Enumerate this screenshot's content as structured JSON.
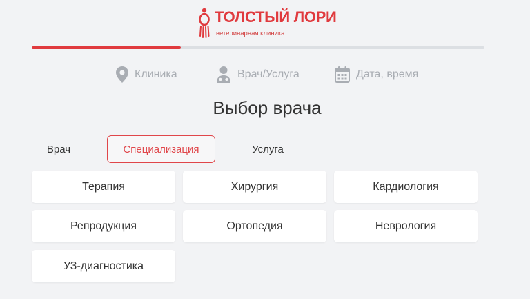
{
  "logo": {
    "title": "ТОЛСТЫЙ ЛОРИ",
    "subtitle": "ветеринарная клиника",
    "brand_color": "#e03a3e"
  },
  "progress": {
    "fraction": 0.33
  },
  "steps": [
    {
      "label": "Клиника",
      "icon": "location-pin-icon"
    },
    {
      "label": "Врач/Услуга",
      "icon": "doctor-icon"
    },
    {
      "label": "Дата, время",
      "icon": "calendar-icon"
    }
  ],
  "page": {
    "title": "Выбор врача"
  },
  "tabs": [
    {
      "label": "Врач",
      "active": false
    },
    {
      "label": "Специализация",
      "active": true
    },
    {
      "label": "Услуга",
      "active": false
    }
  ],
  "specializations": [
    "Терапия",
    "Хирургия",
    "Кардиология",
    "Репродукция",
    "Ортопедия",
    "Неврология",
    "УЗ-диагностика"
  ],
  "colors": {
    "accent": "#e03a3e",
    "inactive_step": "#a9adb3",
    "background": "#f2f3f5"
  }
}
